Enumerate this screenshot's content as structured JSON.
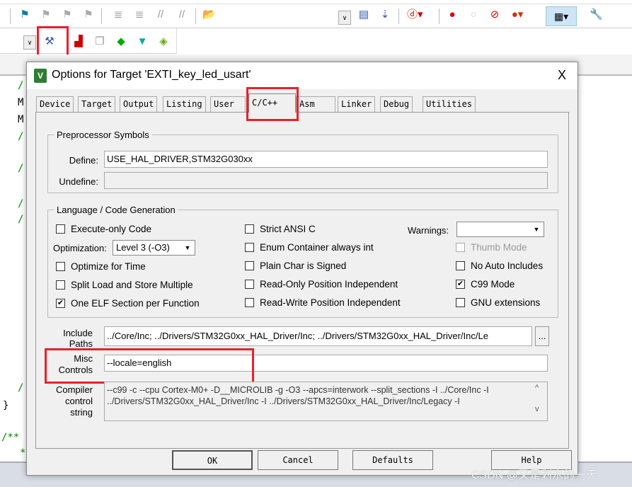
{
  "editor": {
    "gutter": [
      "/",
      "M",
      "M",
      "/",
      "/",
      "/",
      "/",
      "/",
      "}",
      "/**",
      "*"
    ]
  },
  "toolbar": {
    "icons": [
      "bookmark-icon",
      "prev-bookmark-icon",
      "next-bookmark-icon",
      "clear-bookmarks-icon",
      "indent-icon",
      "unindent-icon",
      "comment-icon",
      "uncomment-icon",
      "find-in-files-icon",
      "dropdown",
      "find-icon",
      "insert-icon",
      "debug-icon",
      "breakpoint-icon",
      "disable-breakpoint-icon",
      "kill-breakpoints-icon",
      "clear-breakpoints-icon",
      "window-icon",
      "tools-icon"
    ],
    "row2": [
      "target-options-icon",
      "manage-components-icon",
      "select-packs-icon",
      "pack-installer-icon",
      "filter-icon",
      "software-packs-icon"
    ]
  },
  "dialog": {
    "title": "Options for Target 'EXTI_key_led_usart'",
    "close": "X",
    "tabs": [
      "Device",
      "Target",
      "Output",
      "Listing",
      "User",
      "C/C++",
      "Asm",
      "Linker",
      "Debug",
      "Utilities"
    ],
    "active_tab": "C/C++",
    "preprocessor": {
      "legend": "Preprocessor Symbols",
      "define_label": "Define:",
      "define_value": "USE_HAL_DRIVER,STM32G030xx",
      "undefine_label": "Undefine:",
      "undefine_value": ""
    },
    "codegen": {
      "legend": "Language / Code Generation",
      "optimization_label": "Optimization:",
      "optimization_value": "Level 3 (-O3)",
      "warnings_label": "Warnings:",
      "warnings_value": "",
      "checkboxes": [
        {
          "label": "Execute-only Code",
          "checked": false
        },
        {
          "label": "Optimize for Time",
          "checked": false
        },
        {
          "label": "Split Load and Store Multiple",
          "checked": false
        },
        {
          "label": "One ELF Section per Function",
          "checked": true
        },
        {
          "label": "Strict ANSI C",
          "checked": false
        },
        {
          "label": "Enum Container always int",
          "checked": false
        },
        {
          "label": "Plain Char is Signed",
          "checked": false
        },
        {
          "label": "Read-Only Position Independent",
          "checked": false
        },
        {
          "label": "Read-Write Position Independent",
          "checked": false
        },
        {
          "label": "Thumb Mode",
          "checked": false,
          "disabled": true
        },
        {
          "label": "No Auto Includes",
          "checked": false
        },
        {
          "label": "C99 Mode",
          "checked": true
        },
        {
          "label": "GNU extensions",
          "checked": false
        }
      ]
    },
    "include": {
      "label1": "Include",
      "label2": "Paths",
      "value": "../Core/Inc;    ../Drivers/STM32G0xx_HAL_Driver/Inc;    ../Drivers/STM32G0xx_HAL_Driver/Inc/Le",
      "browse": "..."
    },
    "misc": {
      "label1": "Misc",
      "label2": "Controls",
      "value": "--locale=english"
    },
    "compiler": {
      "label1": "Compiler",
      "label2": "control",
      "label3": "string",
      "line1": "--c99 -c --cpu Cortex-M0+ -D__MICROLIB -g -O3 --apcs=interwork --split_sections -I ../Core/Inc -I",
      "line2": "../Drivers/STM32G0xx_HAL_Driver/Inc -I ../Drivers/STM32G0xx_HAL_Driver/Inc/Legacy -I",
      "up": "^",
      "down": "v"
    },
    "buttons": {
      "ok": "OK",
      "cancel": "Cancel",
      "defaults": "Defaults",
      "help": "Help"
    }
  },
  "watermark": "CSDN @又是划水的一天",
  "colors": {
    "highlight": "#e8212b",
    "comment": "#008000"
  }
}
